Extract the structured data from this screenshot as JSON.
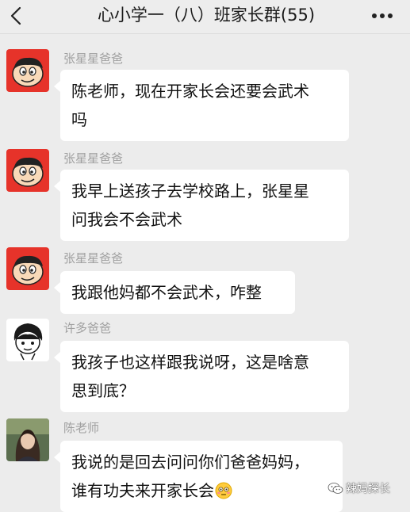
{
  "header": {
    "title": "心小学一（八）班家长群(55)",
    "back_icon": "chevron-left-icon",
    "more_icon": "more-dots-icon"
  },
  "messages": [
    {
      "sender": "张星星爸爸",
      "avatar": "cartoon-boy-avatar",
      "lines": [
        "陈老师，现在开家长会还要会武术",
        "吗"
      ]
    },
    {
      "sender": "张星星爸爸",
      "avatar": "cartoon-boy-avatar",
      "lines": [
        "我早上送孩子去学校路上，张星星",
        "问我会不会武术"
      ]
    },
    {
      "sender": "张星星爸爸",
      "avatar": "cartoon-boy-avatar",
      "lines": [
        "我跟他妈都不会武术，咋整"
      ]
    },
    {
      "sender": "许多爸爸",
      "avatar": "cartoon-face-avatar",
      "lines": [
        "我孩子也这样跟我说呀，这是啥意",
        "思到底？"
      ]
    },
    {
      "sender": "陈老师",
      "avatar": "teacher-photo-avatar",
      "lines": [
        "我说的是回去问问你们爸爸妈妈，",
        "谁有功夫来开家长会"
      ],
      "trailing_emoji": "flushed-face-emoji"
    }
  ],
  "watermark": {
    "text": "辣妈探长",
    "icon": "wechat-logo-icon"
  },
  "colors": {
    "background": "#ececec",
    "bubble": "#ffffff",
    "sender_text": "#a0a0a0",
    "avatar_red": "#e6332a"
  }
}
